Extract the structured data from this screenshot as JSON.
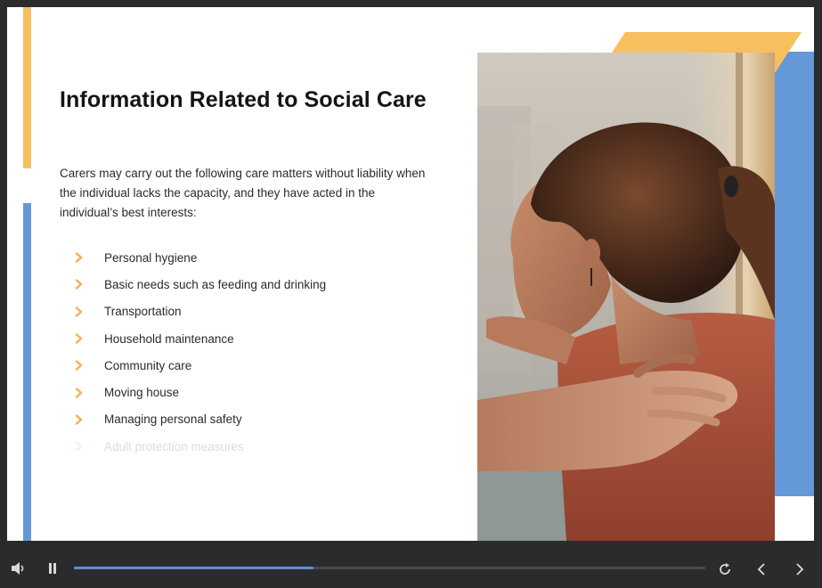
{
  "slide": {
    "title": "Information Related to Social Care",
    "intro": "Carers may carry out the following care matters without liability when the individual lacks the capacity, and they have acted in the individual’s best interests:",
    "bullets": [
      {
        "label": "Personal hygiene",
        "dimmed": false
      },
      {
        "label": "Basic needs such as feeding and drinking",
        "dimmed": false
      },
      {
        "label": "Transportation",
        "dimmed": false
      },
      {
        "label": "Household maintenance",
        "dimmed": false
      },
      {
        "label": "Community care",
        "dimmed": false
      },
      {
        "label": "Moving house",
        "dimmed": false
      },
      {
        "label": "Managing personal safety",
        "dimmed": false
      },
      {
        "label": "Adult protection measures",
        "dimmed": true
      }
    ],
    "bullet_icon": "chevron-right-icon",
    "colors": {
      "accent_yellow": "#f7bf5e",
      "accent_blue": "#6498d8",
      "chevron": "#f5b14c"
    }
  },
  "player": {
    "progress_fraction": 0.38,
    "icons": {
      "volume": "volume-icon",
      "pause": "pause-icon",
      "replay": "replay-icon",
      "prev": "chevron-left-icon",
      "next": "chevron-right-icon"
    },
    "colors": {
      "bar_bg": "#2b2b2d",
      "progress": "#5d8fd4"
    }
  }
}
